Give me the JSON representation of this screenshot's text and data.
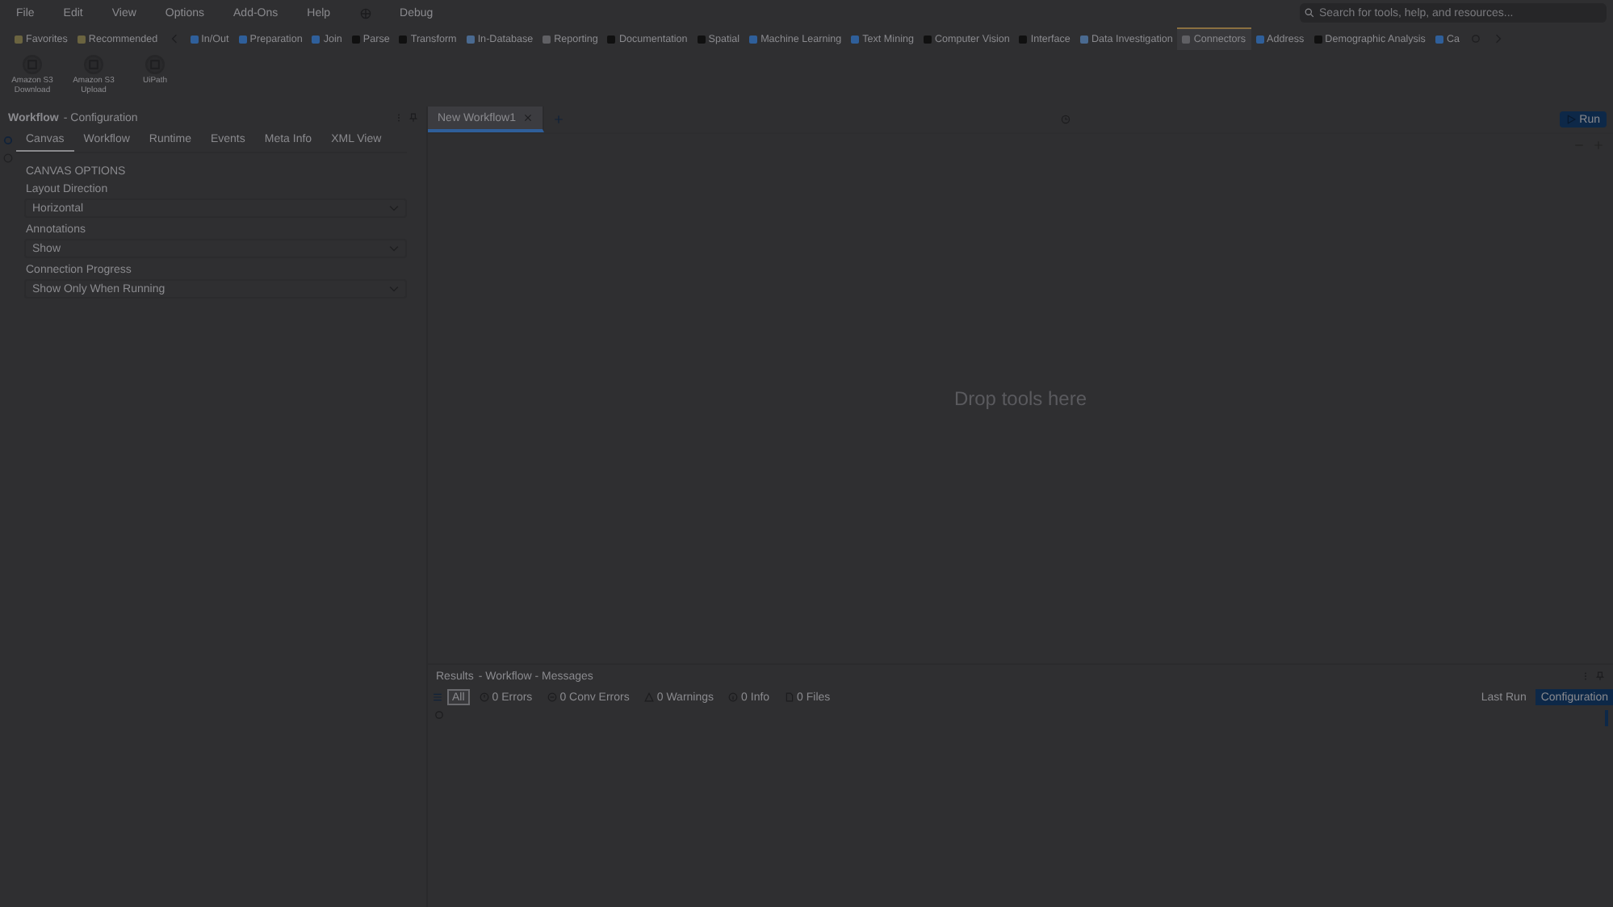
{
  "menu": [
    "File",
    "Edit",
    "View",
    "Options",
    "Add-Ons",
    "Help",
    "Debug"
  ],
  "search": {
    "placeholder": "Search for tools, help, and resources..."
  },
  "categories": [
    {
      "label": "Favorites",
      "color": "#6b6440",
      "selected": false
    },
    {
      "label": "Recommended",
      "color": "#6b6440",
      "selected": false
    },
    {
      "label": "In/Out",
      "color": "#2f5f9a",
      "selected": false
    },
    {
      "label": "Preparation",
      "color": "#2f5f9a",
      "selected": false
    },
    {
      "label": "Join",
      "color": "#2f5f9a",
      "selected": false
    },
    {
      "label": "Parse",
      "color": "#101010",
      "selected": false
    },
    {
      "label": "Transform",
      "color": "#101010",
      "selected": false
    },
    {
      "label": "In-Database",
      "color": "#4a6a90",
      "selected": false
    },
    {
      "label": "Reporting",
      "color": "#606064",
      "selected": false
    },
    {
      "label": "Documentation",
      "color": "#101010",
      "selected": false
    },
    {
      "label": "Spatial",
      "color": "#101010",
      "selected": false
    },
    {
      "label": "Machine Learning",
      "color": "#2f5f9a",
      "selected": false
    },
    {
      "label": "Text Mining",
      "color": "#2f5f9a",
      "selected": false
    },
    {
      "label": "Computer Vision",
      "color": "#101010",
      "selected": false
    },
    {
      "label": "Interface",
      "color": "#101010",
      "selected": false
    },
    {
      "label": "Data Investigation",
      "color": "#4a6a90",
      "selected": false
    },
    {
      "label": "Connectors",
      "color": "#606064",
      "selected": true
    },
    {
      "label": "Address",
      "color": "#2f5f9a",
      "selected": false
    },
    {
      "label": "Demographic Analysis",
      "color": "#101010",
      "selected": false
    },
    {
      "label": "Ca",
      "color": "#2f5f9a",
      "selected": false
    }
  ],
  "tools": [
    {
      "label": "Amazon S3\nDownload"
    },
    {
      "label": "Amazon S3\nUpload"
    },
    {
      "label": "UiPath"
    }
  ],
  "config": {
    "title": "Workflow",
    "subtitle": "- Configuration",
    "tabs": [
      {
        "label": "Canvas",
        "selected": true
      },
      {
        "label": "Workflow",
        "selected": false
      },
      {
        "label": "Runtime",
        "selected": false
      },
      {
        "label": "Events",
        "selected": false
      },
      {
        "label": "Meta Info",
        "selected": false
      },
      {
        "label": "XML View",
        "selected": false
      }
    ],
    "section": "CANVAS OPTIONS",
    "fields": [
      {
        "label": "Layout Direction",
        "value": "Horizontal"
      },
      {
        "label": "Annotations",
        "value": "Show"
      },
      {
        "label": "Connection Progress",
        "value": "Show Only When Running"
      }
    ]
  },
  "workflow_tabs": [
    {
      "label": "New Workflow1",
      "selected": true
    }
  ],
  "run_button": "Run",
  "canvas": {
    "hint": "Drop tools here"
  },
  "results": {
    "title": "Results",
    "subtitle": "- Workflow - Messages",
    "filters": [
      {
        "label": "All",
        "kind": "all",
        "selected": true
      },
      {
        "label": "0 Errors",
        "kind": "errors",
        "selected": false
      },
      {
        "label": "0 Conv Errors",
        "kind": "conv",
        "selected": false
      },
      {
        "label": "0 Warnings",
        "kind": "warnings",
        "selected": false
      },
      {
        "label": "0 Info",
        "kind": "info",
        "selected": false
      },
      {
        "label": "0 Files",
        "kind": "files",
        "selected": false
      }
    ],
    "views": [
      {
        "label": "Last Run",
        "selected": false
      },
      {
        "label": "Configuration",
        "selected": true
      }
    ]
  }
}
